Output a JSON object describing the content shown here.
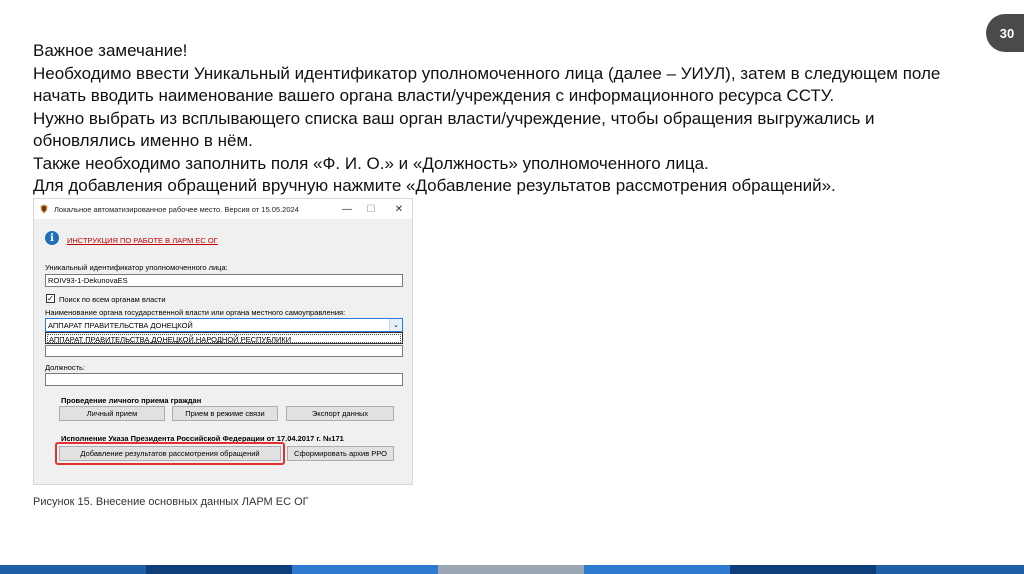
{
  "slide": {
    "number": "30",
    "lines": [
      "Важное замечание!",
      "Необходимо ввести Уникальный идентификатор уполномоченного лица (далее – УИУЛ), затем в следующем поле",
      "начать вводить наименование вашего органа власти/учреждения с информационного ресурса ССТУ.",
      "Нужно выбрать из всплывающего списка ваш орган власти/учреждение, чтобы обращения выгружались и",
      "обновлялись именно в нём.",
      "Также необходимо заполнить поля «Ф. И. О.» и «Должность» уполномоченного лица.",
      "Для добавления обращений вручную нажмите «Добавление результатов рассмотрения обращений»."
    ],
    "caption": "Рисунок 15. Внесение основных данных ЛАРМ ЕС ОГ"
  },
  "window": {
    "title": "Локальное автоматизированное рабочее место. Версия от 15.05.2024",
    "minimize": "—",
    "maximize": "☐",
    "close": "✕",
    "info_link": "ИНСТРУКЦИЯ ПО РАБОТЕ В ЛАРМ ЕС ОГ",
    "uiul_label": "Уникальный идентификатор уполномоченного лица:",
    "uiul_value": "ROIV93-1-DekunovaES",
    "search_all_label": "Поиск по всем органам власти",
    "search_all_checked": "✓",
    "org_label": "Наименование органа государственной власти или органа местного самоуправления:",
    "org_value": "АППАРАТ ПРАВИТЕЛЬСТВА ДОНЕЦКОЙ",
    "org_arrow": "⌄",
    "org_suggestion": "АППАРАТ ПРАВИТЕЛЬСТВА ДОНЕЦКОЙ НАРОДНОЙ РЕСПУБЛИКИ",
    "position_label": "Должность:",
    "reception_title": "Проведение личного приема граждан",
    "btn_personal": "Личный прием",
    "btn_remote": "Прием в режиме связи",
    "btn_export": "Экспорт данных",
    "decree_title": "Исполнение Указа Президента Российской Федерации от 17.04.2017 г. №171",
    "btn_add_results": "Добавление результатов рассмотрения обращений",
    "btn_archive": "Сформировать архив РРО"
  },
  "colors": {
    "badge": "#4a4a4a",
    "link": "#c00000",
    "highlight": "#e03030",
    "bar1": "#1f5fa8",
    "bar2": "#0e3f7a",
    "bar3": "#2e7ad1",
    "bar4": "#9aa6b2"
  }
}
